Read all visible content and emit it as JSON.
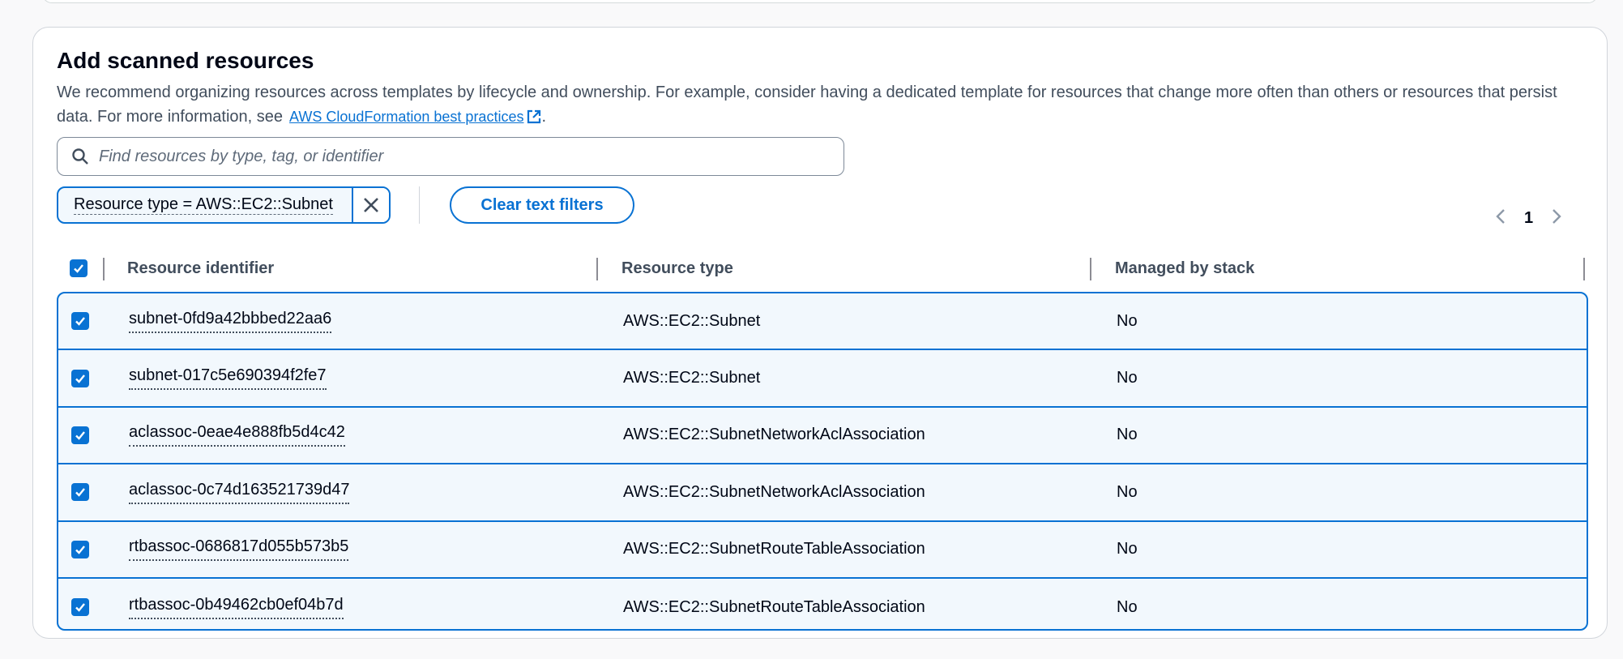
{
  "section": {
    "title": "Add scanned resources",
    "description": "We recommend organizing resources across templates by lifecycle and ownership. For example, consider having a dedicated template for resources that change more often than others or resources that persist data. For more information, see",
    "link_label": "AWS CloudFormation best practices",
    "link_suffix": "."
  },
  "search": {
    "placeholder": "Find resources by type, tag, or identifier",
    "value": ""
  },
  "filter_token": {
    "label": "Resource type = AWS::EC2::Subnet"
  },
  "clear_filters_label": "Clear text filters",
  "pagination": {
    "current_page": "1"
  },
  "table": {
    "columns": [
      "Resource identifier",
      "Resource type",
      "Managed by stack"
    ],
    "rows": [
      {
        "identifier": "subnet-0fd9a42bbbed22aa6",
        "type": "AWS::EC2::Subnet",
        "managed": "No"
      },
      {
        "identifier": "subnet-017c5e690394f2fe7",
        "type": "AWS::EC2::Subnet",
        "managed": "No"
      },
      {
        "identifier": "aclassoc-0eae4e888fb5d4c42",
        "type": "AWS::EC2::SubnetNetworkAclAssociation",
        "managed": "No"
      },
      {
        "identifier": "aclassoc-0c74d163521739d47",
        "type": "AWS::EC2::SubnetNetworkAclAssociation",
        "managed": "No"
      },
      {
        "identifier": "rtbassoc-0686817d055b573b5",
        "type": "AWS::EC2::SubnetRouteTableAssociation",
        "managed": "No"
      },
      {
        "identifier": "rtbassoc-0b49462cb0ef04b7d",
        "type": "AWS::EC2::SubnetRouteTableAssociation",
        "managed": "No"
      }
    ]
  },
  "colors": {
    "accent": "#0972d3",
    "selected_row_bg": "#f2f8fd",
    "text_primary": "#000716",
    "text_secondary": "#414d5c"
  }
}
